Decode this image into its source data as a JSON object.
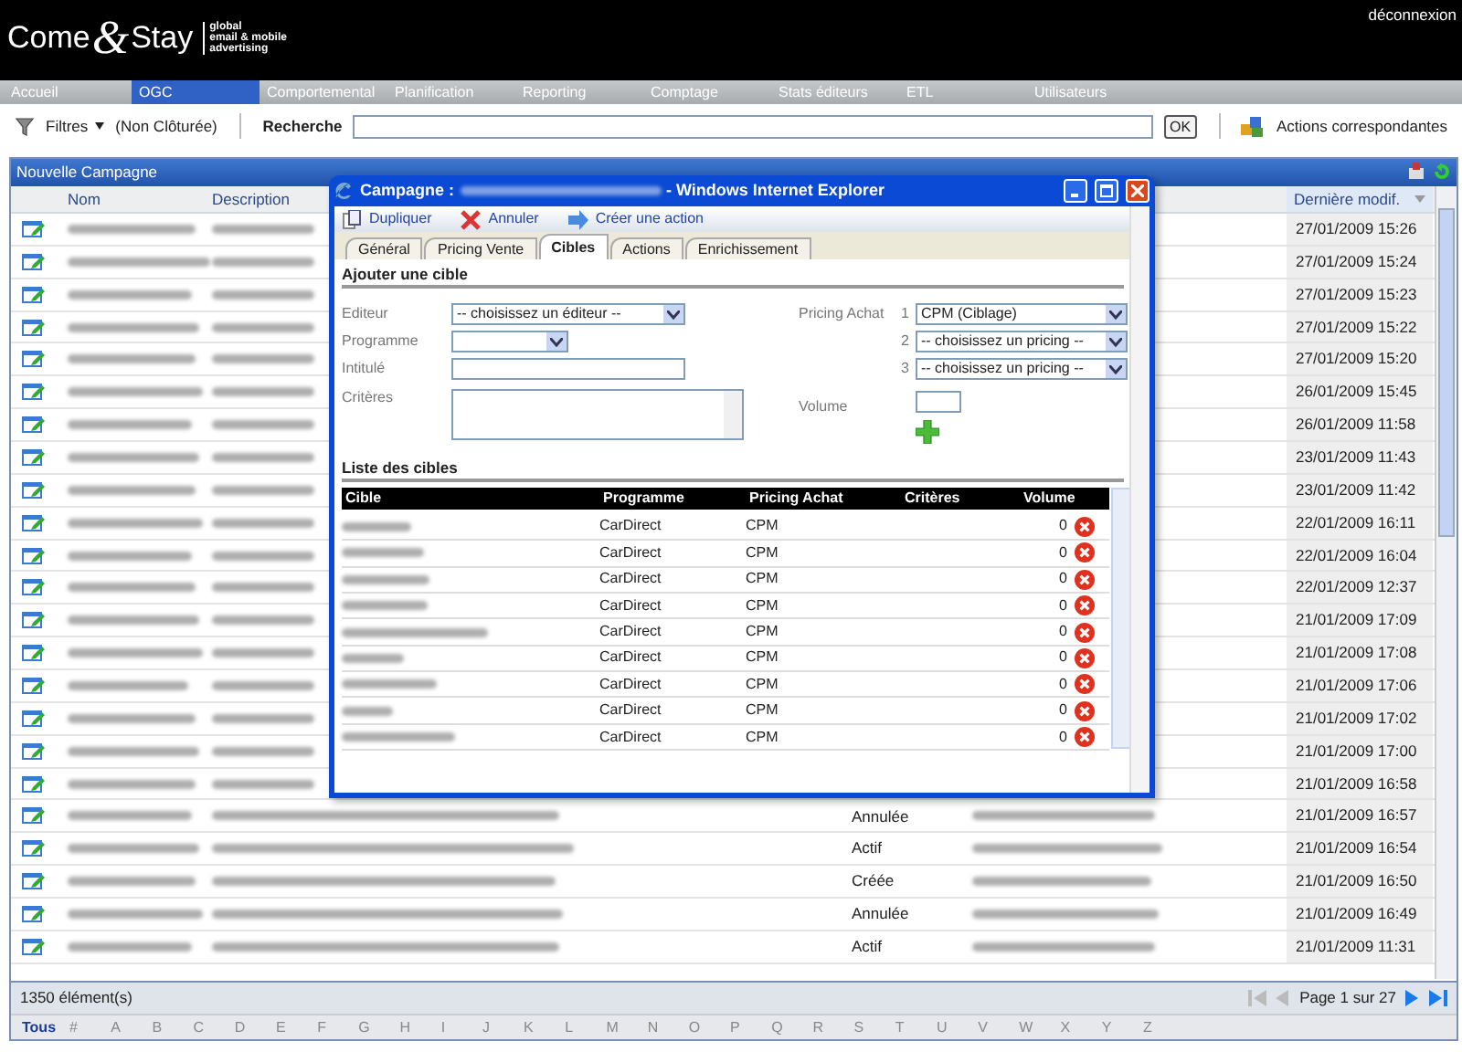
{
  "header": {
    "logo": {
      "come": "Come",
      "amp": "&",
      "stay": "Stay",
      "tagline": [
        "global",
        "email & mobile",
        "advertising"
      ]
    },
    "logout": "déconnexion"
  },
  "menu": [
    {
      "label": "Accueil",
      "selected": false
    },
    {
      "label": "OGC",
      "selected": true
    },
    {
      "label": "Comportemental",
      "selected": false
    },
    {
      "label": "Planification",
      "selected": false
    },
    {
      "label": "Reporting",
      "selected": false
    },
    {
      "label": "Comptage",
      "selected": false
    },
    {
      "label": "Stats éditeurs",
      "selected": false
    },
    {
      "label": "ETL",
      "selected": false
    },
    {
      "label": "Utilisateurs",
      "selected": false
    }
  ],
  "toolbar": {
    "filters": "Filtres",
    "filter_state": "(Non Clôturée)",
    "search_label": "Recherche",
    "search_button": "OK",
    "actions": "Actions correspondantes"
  },
  "grid": {
    "title": "Nouvelle Campagne",
    "columns": [
      "Nom",
      "Description",
      "Dernière modif."
    ],
    "rows": [
      {
        "modified": "27/01/2009 15:26"
      },
      {
        "modified": "27/01/2009 15:24"
      },
      {
        "modified": "27/01/2009 15:23"
      },
      {
        "modified": "27/01/2009 15:22"
      },
      {
        "modified": "27/01/2009 15:20"
      },
      {
        "modified": "26/01/2009 15:45"
      },
      {
        "modified": "26/01/2009 11:58"
      },
      {
        "modified": "23/01/2009 11:43"
      },
      {
        "modified": "23/01/2009 11:42"
      },
      {
        "modified": "22/01/2009 16:11"
      },
      {
        "modified": "22/01/2009 16:04"
      },
      {
        "modified": "22/01/2009 12:37"
      },
      {
        "modified": "21/01/2009 17:09"
      },
      {
        "modified": "21/01/2009 17:08"
      },
      {
        "modified": "21/01/2009 17:06"
      },
      {
        "modified": "21/01/2009 17:02"
      },
      {
        "modified": "21/01/2009 17:00"
      },
      {
        "modified": "21/01/2009 16:58"
      },
      {
        "status": "Annulée",
        "modified": "21/01/2009 16:57"
      },
      {
        "status": "Actif",
        "modified": "21/01/2009 16:54"
      },
      {
        "status": "Créée",
        "modified": "21/01/2009 16:50"
      },
      {
        "status": "Annulée",
        "modified": "21/01/2009 16:49"
      },
      {
        "status": "Actif",
        "modified": "21/01/2009 11:31"
      }
    ],
    "count": "1350 élément(s)",
    "pager": "Page 1 sur 27",
    "pager_buttons": [
      {
        "kind": "first",
        "disabled": true
      },
      {
        "kind": "prev",
        "disabled": true
      },
      {
        "kind": "next",
        "disabled": false
      },
      {
        "kind": "last",
        "disabled": false
      }
    ],
    "letters": [
      {
        "label": "Tous",
        "selected": true
      },
      {
        "label": "#",
        "selected": false
      },
      {
        "label": "A",
        "selected": false
      },
      {
        "label": "B",
        "selected": false
      },
      {
        "label": "C",
        "selected": false
      },
      {
        "label": "D",
        "selected": false
      },
      {
        "label": "E",
        "selected": false
      },
      {
        "label": "F",
        "selected": false
      },
      {
        "label": "G",
        "selected": false
      },
      {
        "label": "H",
        "selected": false
      },
      {
        "label": "I",
        "selected": false
      },
      {
        "label": "J",
        "selected": false
      },
      {
        "label": "K",
        "selected": false
      },
      {
        "label": "L",
        "selected": false
      },
      {
        "label": "M",
        "selected": false
      },
      {
        "label": "N",
        "selected": false
      },
      {
        "label": "O",
        "selected": false
      },
      {
        "label": "P",
        "selected": false
      },
      {
        "label": "Q",
        "selected": false
      },
      {
        "label": "R",
        "selected": false
      },
      {
        "label": "S",
        "selected": false
      },
      {
        "label": "T",
        "selected": false
      },
      {
        "label": "U",
        "selected": false
      },
      {
        "label": "V",
        "selected": false
      },
      {
        "label": "W",
        "selected": false
      },
      {
        "label": "X",
        "selected": false
      },
      {
        "label": "Y",
        "selected": false
      },
      {
        "label": "Z",
        "selected": false
      }
    ]
  },
  "popup": {
    "title_prefix": "Campagne :",
    "title_suffix": "- Windows Internet Explorer",
    "actions": [
      {
        "kind": "duplicate",
        "label": "Dupliquer"
      },
      {
        "kind": "cancel",
        "label": "Annuler"
      },
      {
        "kind": "create",
        "label": "Créer une action"
      }
    ],
    "tabs": [
      {
        "label": "Général",
        "selected": false
      },
      {
        "label": "Pricing Vente",
        "selected": false
      },
      {
        "label": "Cibles",
        "selected": true
      },
      {
        "label": "Actions",
        "selected": false
      },
      {
        "label": "Enrichissement",
        "selected": false
      }
    ],
    "add_heading": "Ajouter une cible",
    "editor": {
      "label": "Editeur",
      "value": "-- choisissez un éditeur --"
    },
    "program": {
      "label": "Programme"
    },
    "title_field": {
      "label": "Intitulé"
    },
    "criteria": {
      "label": "Critères"
    },
    "pricing": {
      "label": "Pricing Achat",
      "choices": [
        {
          "number": "1",
          "value": "CPM (Ciblage)"
        },
        {
          "number": "2",
          "value": "-- choisissez un pricing --"
        },
        {
          "number": "3",
          "value": "-- choisissez un pricing --"
        }
      ]
    },
    "volume": {
      "label": "Volume"
    },
    "list_heading": "Liste des cibles",
    "columns": [
      "Cible",
      "Programme",
      "Pricing Achat",
      "Critères",
      "Volume"
    ],
    "rows": [
      {
        "program": "CarDirect",
        "pricing": "CPM",
        "volume": "0"
      },
      {
        "program": "CarDirect",
        "pricing": "CPM",
        "volume": "0"
      },
      {
        "program": "CarDirect",
        "pricing": "CPM",
        "volume": "0"
      },
      {
        "program": "CarDirect",
        "pricing": "CPM",
        "volume": "0"
      },
      {
        "program": "CarDirect",
        "pricing": "CPM",
        "volume": "0"
      },
      {
        "program": "CarDirect",
        "pricing": "CPM",
        "volume": "0"
      },
      {
        "program": "CarDirect",
        "pricing": "CPM",
        "volume": "0"
      },
      {
        "program": "CarDirect",
        "pricing": "CPM",
        "volume": "0"
      },
      {
        "program": "CarDirect",
        "pricing": "CPM",
        "volume": "0"
      }
    ]
  }
}
